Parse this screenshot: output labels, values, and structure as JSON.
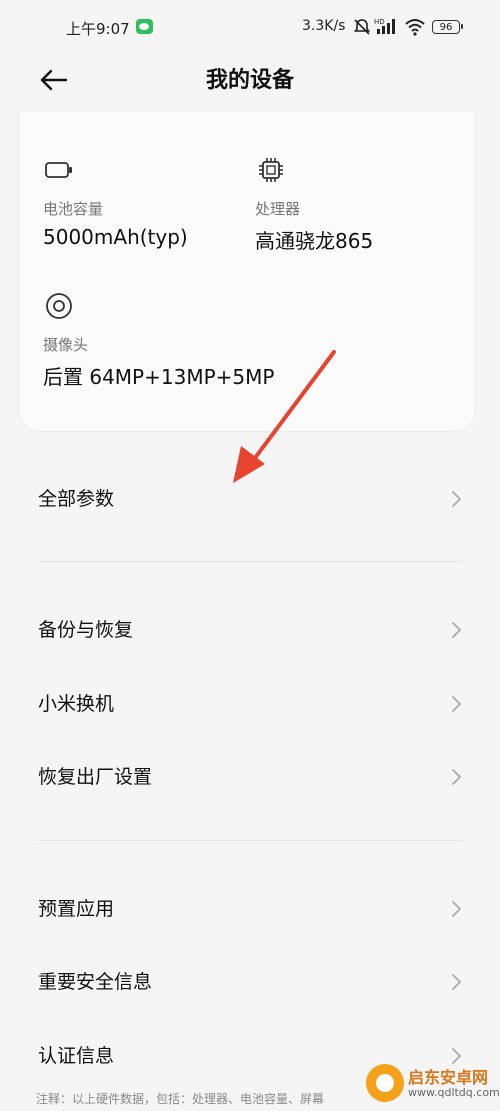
{
  "status_bar": {
    "time": "上午9:07",
    "net_speed": "3.3K/s",
    "battery": "96"
  },
  "header": {
    "title": "我的设备"
  },
  "specs": {
    "battery": {
      "label": "电池容量",
      "value": "5000mAh(typ)",
      "icon": "battery-icon"
    },
    "processor": {
      "label": "处理器",
      "value": "高通骁龙865",
      "icon": "chip-icon"
    },
    "camera": {
      "label": "摄像头",
      "value": "后置 64MP+13MP+5MP",
      "icon": "camera-icon"
    }
  },
  "menu": {
    "all_params": "全部参数",
    "backup_restore": "备份与恢复",
    "mi_mover": "小米换机",
    "factory_reset": "恢复出厂设置",
    "preinstalled_apps": "预置应用",
    "safety_info": "重要安全信息",
    "certification": "认证信息"
  },
  "footnote": "注释：以上硬件数据，包括：处理器、电池容量、屏幕",
  "watermark": {
    "name": "启东安卓网",
    "url": "www.qdltdq.com"
  },
  "colors": {
    "background": "#f5f5f5",
    "card": "#fbfbfb",
    "annotation_arrow": "#e8432e",
    "wechat_badge": "#2ec05b"
  }
}
